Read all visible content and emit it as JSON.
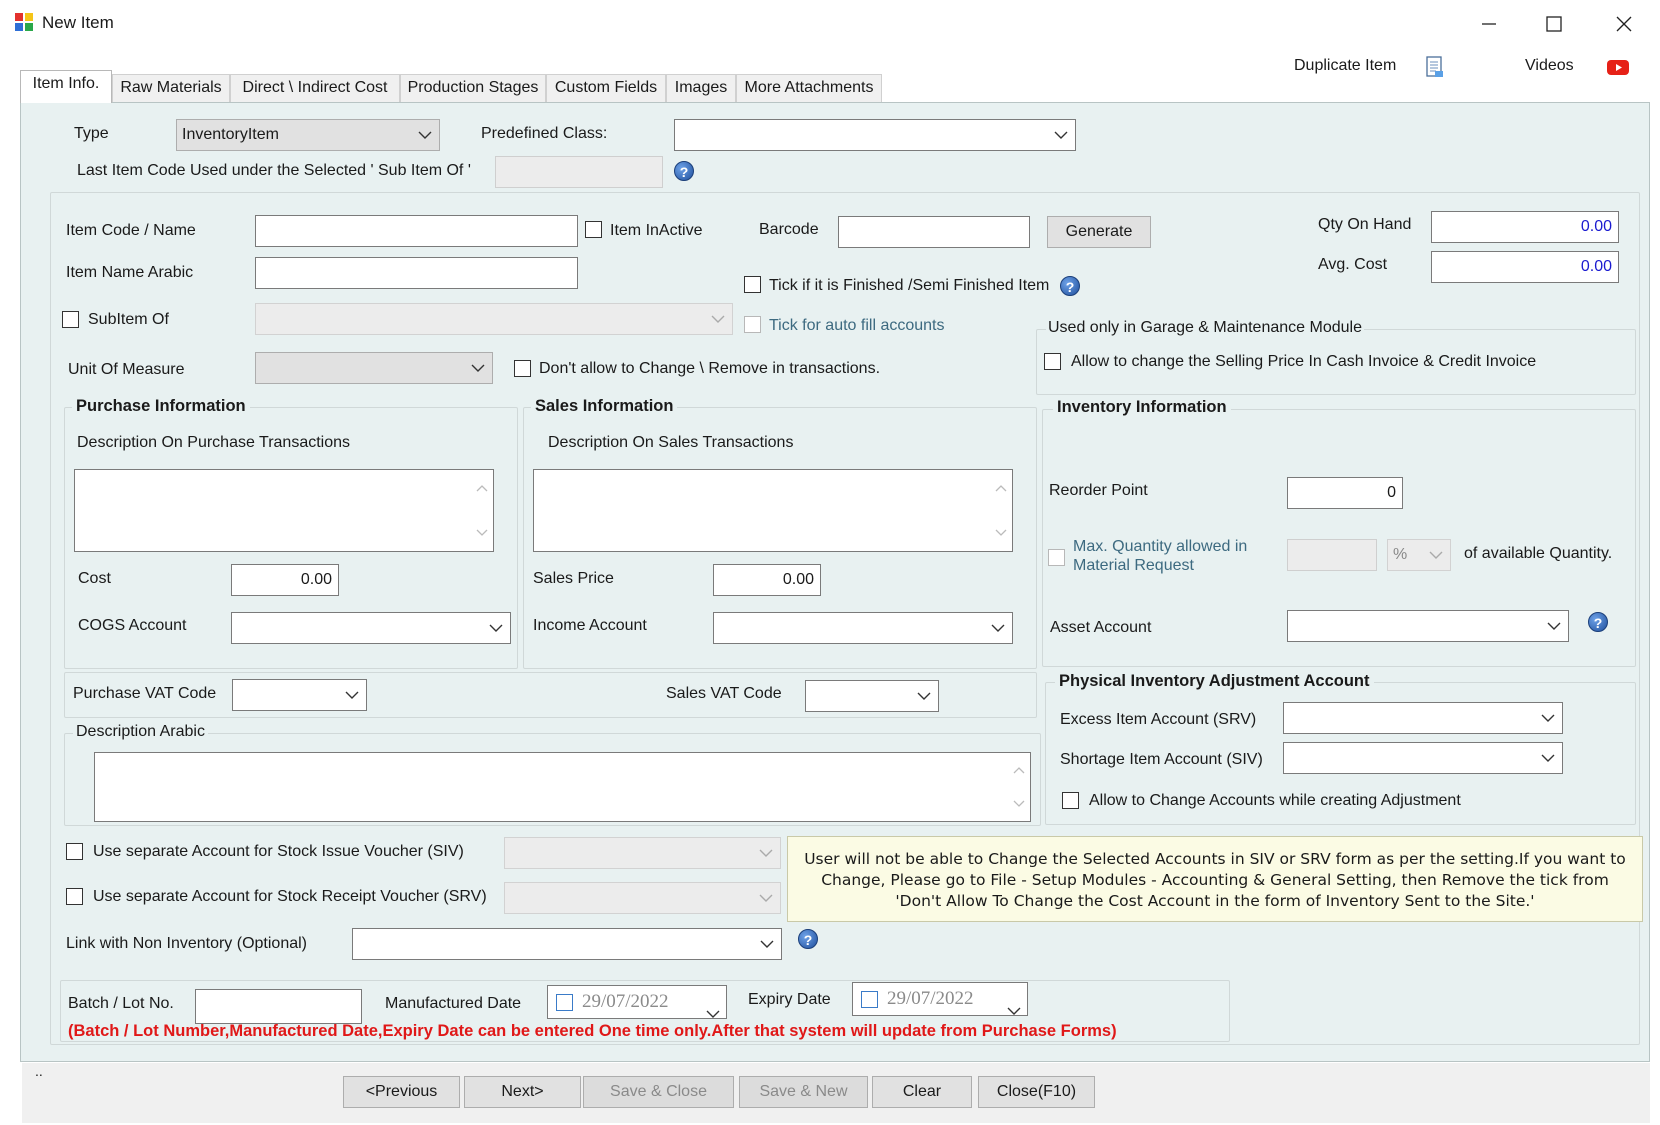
{
  "window": {
    "title": "New Item",
    "controls": {
      "minimize": "minimize",
      "maximize": "maximize",
      "close": "close"
    }
  },
  "toolbar": {
    "duplicate_label": "Duplicate Item",
    "videos_label": "Videos"
  },
  "tabs": [
    {
      "label": "Item Info.",
      "active": true
    },
    {
      "label": "Raw Materials"
    },
    {
      "label": "Direct \\ Indirect Cost"
    },
    {
      "label": "Production Stages"
    },
    {
      "label": "Custom Fields"
    },
    {
      "label": "Images"
    },
    {
      "label": "More Attachments"
    }
  ],
  "header": {
    "type_label": "Type",
    "type_value": "InventoryItem",
    "predefined_label": "Predefined Class:",
    "predefined_value": "",
    "last_code_label": "Last Item Code Used under the Selected ' Sub Item Of '"
  },
  "item": {
    "code_label": "Item Code / Name",
    "code_value": "",
    "inactive_label": "Item InActive",
    "barcode_label": "Barcode",
    "barcode_value": "",
    "generate_label": "Generate",
    "qty_label": "Qty On Hand",
    "qty_value": "0.00",
    "avg_label": "Avg. Cost",
    "avg_value": "0.00",
    "arabic_label": "Item Name Arabic",
    "finished_label": "Tick if it is Finished /Semi Finished Item",
    "subitem_label": "SubItem Of",
    "autofill_label": "Tick for auto fill accounts",
    "uom_label": "Unit Of Measure",
    "dont_allow_label": "Don't allow to Change \\ Remove in transactions."
  },
  "garage": {
    "title": "Used only in Garage & Maintenance Module",
    "allow_label": "Allow to change the Selling Price In Cash Invoice & Credit Invoice"
  },
  "purchase": {
    "title": "Purchase Information",
    "desc_label": "Description On  Purchase Transactions",
    "cost_label": "Cost",
    "cost_value": "0.00",
    "cogs_label": "COGS Account",
    "vat_label": "Purchase VAT Code"
  },
  "sales": {
    "title": "Sales Information",
    "desc_label": "Description On Sales Transactions",
    "price_label": "Sales Price",
    "price_value": "0.00",
    "income_label": "Income Account",
    "vat_label": "Sales VAT Code"
  },
  "inventory": {
    "title": "Inventory Information",
    "reorder_label": "Reorder Point",
    "reorder_value": "0",
    "maxqty_label_1": "Max. Quantity allowed in",
    "maxqty_label_2": "Material Request",
    "pct_value": "%",
    "available_label": "of available Quantity.",
    "asset_label": "Asset Account"
  },
  "physical": {
    "title": "Physical Inventory Adjustment Account",
    "excess_label": "Excess Item Account (SRV)",
    "shortage_label": "Shortage Item Account (SIV)",
    "allow_label": "Allow to Change Accounts while creating Adjustment"
  },
  "desc_arabic_label": "Description Arabic",
  "siv_label": "Use separate Account for Stock Issue Voucher (SIV)",
  "srv_label": "Use separate Account for Stock Receipt Voucher (SRV)",
  "note_text": "User will not be able to Change the Selected Accounts in SIV or SRV form as per the setting.If you want to Change, Please go to File - Setup Modules - Accounting & General Setting, then Remove the tick from 'Don't Allow To Change the Cost Account in the form of Inventory Sent to the Site.'",
  "link_label": "Link with Non Inventory (Optional)",
  "batch": {
    "label": "Batch / Lot No.",
    "manufactured_label": "Manufactured Date",
    "manufactured_value": "29/07/2022",
    "expiry_label": "Expiry Date",
    "expiry_value": "29/07/2022",
    "warning": "(Batch / Lot Number,Manufactured Date,Expiry Date can be entered One time only.After that system will update from Purchase Forms)"
  },
  "status_text": "..",
  "footer": {
    "previous": "<Previous",
    "next": "Next>",
    "save_close": "Save & Close",
    "save_new": "Save & New",
    "clear": "Clear",
    "close": "Close(F10)"
  },
  "colors": {
    "panel": "#e8f1f1",
    "warning_red": "#e01818",
    "note_bg": "#fbfbe4",
    "value_blue": "#1a1ad0"
  }
}
